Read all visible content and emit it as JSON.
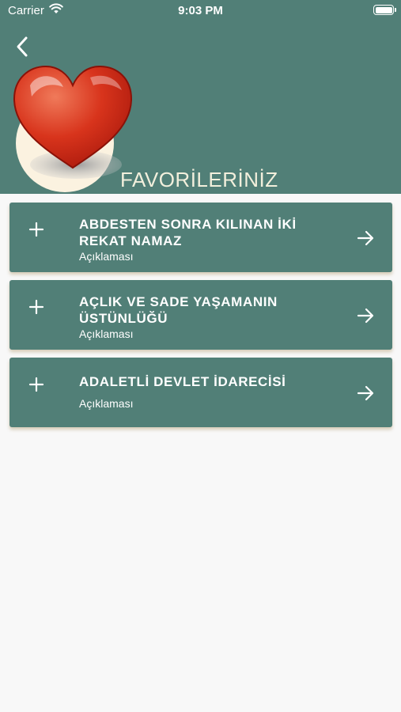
{
  "status_bar": {
    "carrier": "Carrier",
    "time": "9:03 PM"
  },
  "header": {
    "title": "FAVORİLERİNİZ",
    "background": "#517f77",
    "title_color": "#f2efdc"
  },
  "icons": {
    "back": "chevron-left-icon",
    "logo": "heart-icon",
    "expand": "plus-icon",
    "open": "arrow-right-icon"
  },
  "favorites": [
    {
      "title": "ABDESTEN SONRA KILINAN İKİ REKAT NAMAZ",
      "subtitle": "Açıklaması"
    },
    {
      "title": "AÇLIK VE SADE YAŞAMANIN ÜSTÜNLÜĞÜ",
      "subtitle": "Açıklaması"
    },
    {
      "title": "ADALETLİ DEVLET İDARECİSİ",
      "subtitle": "Açıklaması"
    }
  ]
}
